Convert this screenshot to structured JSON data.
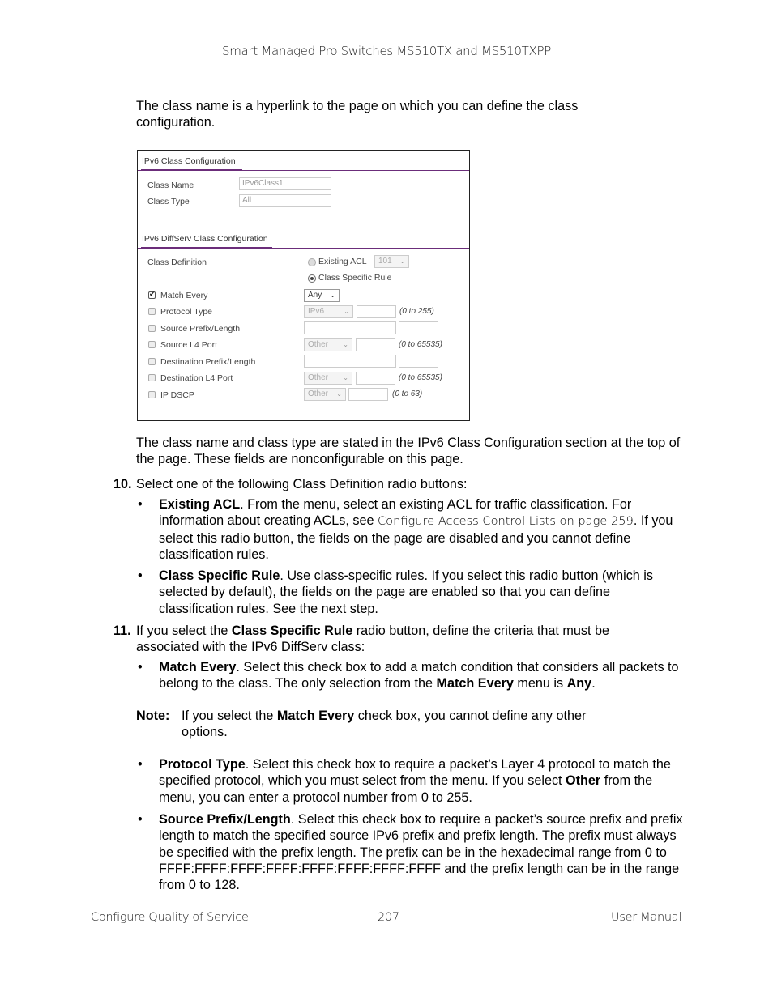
{
  "header": {
    "title": "Smart Managed Pro Switches MS510TX and MS510TXPP"
  },
  "intro": "The class name is a hyperlink to the page on which you can define the class configuration.",
  "screenshot": {
    "section1_title": "IPv6 Class Configuration",
    "class_name_label": "Class Name",
    "class_name_value": "IPv6Class1",
    "class_type_label": "Class Type",
    "class_type_value": "All",
    "section2_title": "IPv6 DiffServ Class Configuration",
    "class_definition_label": "Class Definition",
    "radio_existing_acl": "Existing ACL",
    "existing_acl_value": "101",
    "radio_class_specific": "Class Specific Rule",
    "rows": [
      {
        "label": "Match Every",
        "checked": true,
        "select": "Any",
        "range": ""
      },
      {
        "label": "Protocol Type",
        "checked": false,
        "select": "IPv6",
        "range": "(0 to 255)"
      },
      {
        "label": "Source Prefix/Length",
        "checked": false,
        "select": "",
        "range": ""
      },
      {
        "label": "Source L4 Port",
        "checked": false,
        "select": "Other",
        "range": "(0 to 65535)"
      },
      {
        "label": "Destination Prefix/Length",
        "checked": false,
        "select": "",
        "range": ""
      },
      {
        "label": "Destination L4 Port",
        "checked": false,
        "select": "Other",
        "range": "(0 to 65535)"
      },
      {
        "label": "IP DSCP",
        "checked": false,
        "select": "Other",
        "range": "(0 to 63)"
      }
    ],
    "chevron": "⌄"
  },
  "para_after_shot": "The class name and class type are stated in the IPv6 Class Configuration section at the top of the page. These fields are nonconfigurable on this page.",
  "step10": {
    "num": "10.",
    "text": "Select one of the following Class Definition radio buttons:",
    "bullets": [
      {
        "bold": "Existing ACL",
        "text1": ". From the menu, select an existing ACL for traffic classification. For information about creating ACLs, see ",
        "link": "Configure Access Control Lists on page 259",
        "text2": ". If you select this radio button, the fields on the page are disabled and you cannot define classification rules."
      },
      {
        "bold": "Class Specific Rule",
        "text1": ". Use class-specific rules. If you select this radio button (which is selected by default), the fields on the page are enabled so that you can define classification rules. See the next step."
      }
    ]
  },
  "step11": {
    "num": "11.",
    "pre": "If you select the ",
    "bold": "Class Specific Rule",
    "post": " radio button, define the criteria that must be associated with the IPv6 DiffServ class:",
    "match_every": {
      "bold": "Match Every",
      "text1": ". Select this check box to add a match condition that considers all packets to belong to the class. The only selection from the ",
      "bold2": "Match Every",
      "text2": " menu is ",
      "bold3": "Any",
      "text3": "."
    },
    "note": {
      "label": "Note:",
      "pre": "If you select the ",
      "bold": "Match Every",
      "post": " check box, you cannot define any other options."
    },
    "protocol_type": {
      "bold": "Protocol Type",
      "text1": ". Select this check box to require a packet’s Layer 4 protocol to match the specified protocol, which you must select from the menu. If you select ",
      "bold2": "Other",
      "text2": " from the menu, you can enter a protocol number from 0 to 255."
    },
    "source_prefix": {
      "bold": "Source Prefix/Length",
      "text1": ". Select this check box to require a packet’s source prefix and prefix length to match the specified source IPv6 prefix and prefix length. The prefix must always be specified with the prefix length. The prefix can be in the hexadecimal range from 0 to FFFF:FFFF:FFFF:FFFF:FFFF:FFFF:FFFF:FFFF and the prefix length can be in the range from 0 to 128."
    }
  },
  "bullet_glyph": "•",
  "footer": {
    "left": "Configure Quality of Service",
    "center": "207",
    "right": "User Manual"
  }
}
